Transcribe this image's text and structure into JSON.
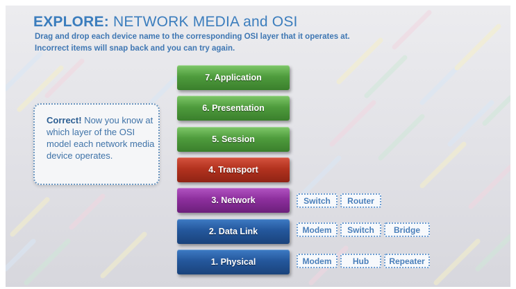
{
  "title": {
    "bold": "EXPLORE:",
    "rest": " NETWORK MEDIA and OSI"
  },
  "instructions": [
    "Drag and drop each device name to the corresponding OSI layer that it operates at.",
    "Incorrect items will snap back and you can try again."
  ],
  "feedback": {
    "bold": "Correct!",
    "text": " Now you know at which layer of the OSI model each network media device operates."
  },
  "layers": [
    {
      "label": "7. Application",
      "color": "green"
    },
    {
      "label": "6. Presentation",
      "color": "green"
    },
    {
      "label": "5. Session",
      "color": "green"
    },
    {
      "label": "4. Transport",
      "color": "red"
    },
    {
      "label": "3. Network",
      "color": "purple"
    },
    {
      "label": "2. Data Link",
      "color": "blue"
    },
    {
      "label": "1. Physical",
      "color": "blue"
    }
  ],
  "devices": {
    "network": [
      "Switch",
      "Router"
    ],
    "data_link": [
      "Modem",
      "Switch",
      "Bridge"
    ],
    "physical": [
      "Modem",
      "Hub",
      "Repeater"
    ]
  },
  "colors": {
    "title": "#3b7dbd",
    "layer_green": "#4f9c3d",
    "layer_red": "#b3321f",
    "layer_purple": "#8d2f9d",
    "layer_blue": "#24579c",
    "chip_border": "#6b9bd0"
  }
}
